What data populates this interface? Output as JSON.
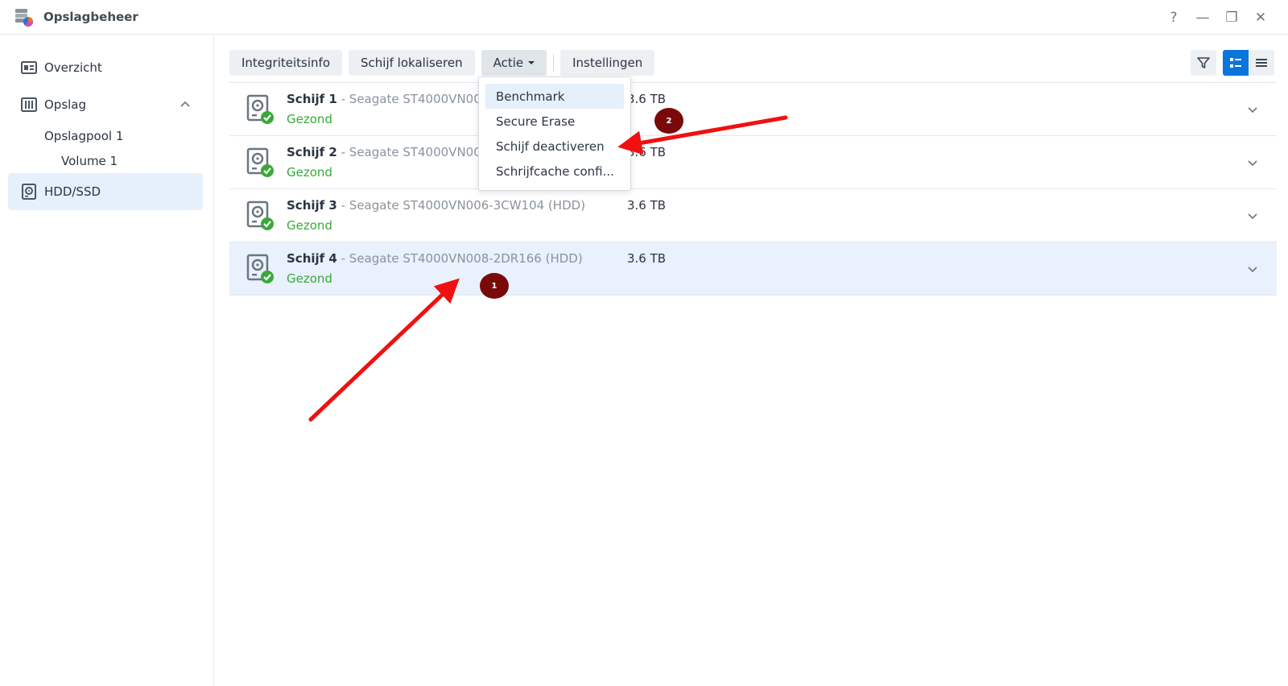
{
  "window": {
    "title": "Opslagbeheer",
    "controls": {
      "help": "?",
      "minimize": "—",
      "restore": "❐",
      "close": "✕"
    }
  },
  "sidebar": {
    "overview": "Overzicht",
    "storage": "Opslag",
    "pool": "Opslagpool 1",
    "volume": "Volume 1",
    "hdd": "HDD/SSD"
  },
  "toolbar": {
    "integrity": "Integriteitsinfo",
    "locate": "Schijf lokaliseren",
    "action": "Actie",
    "settings": "Instellingen"
  },
  "disks": [
    {
      "name": "Schijf 1",
      "model": " - Seagate ST4000VN00",
      "status": "Gezond",
      "size": "3.6 TB"
    },
    {
      "name": "Schijf 2",
      "model": " - Seagate ST4000VN00",
      "status": "Gezond",
      "size": "3.6 TB"
    },
    {
      "name": "Schijf 3",
      "model": " - Seagate ST4000VN006-3CW104 (HDD)",
      "status": "Gezond",
      "size": "3.6 TB"
    },
    {
      "name": "Schijf 4",
      "model": " - Seagate ST4000VN008-2DR166 (HDD)",
      "status": "Gezond",
      "size": "3.6 TB"
    }
  ],
  "action_menu": [
    "Benchmark",
    "Secure Erase",
    "Schijf deactiveren",
    "Schrijfcache confi..."
  ],
  "annotations": {
    "badge1": "1",
    "badge2": "2"
  },
  "colors": {
    "accent": "#0a75dd",
    "healthy": "#39a839",
    "selected_row": "#e9f1fc",
    "arrow": "#f01010",
    "badge": "#7a0a0a"
  }
}
